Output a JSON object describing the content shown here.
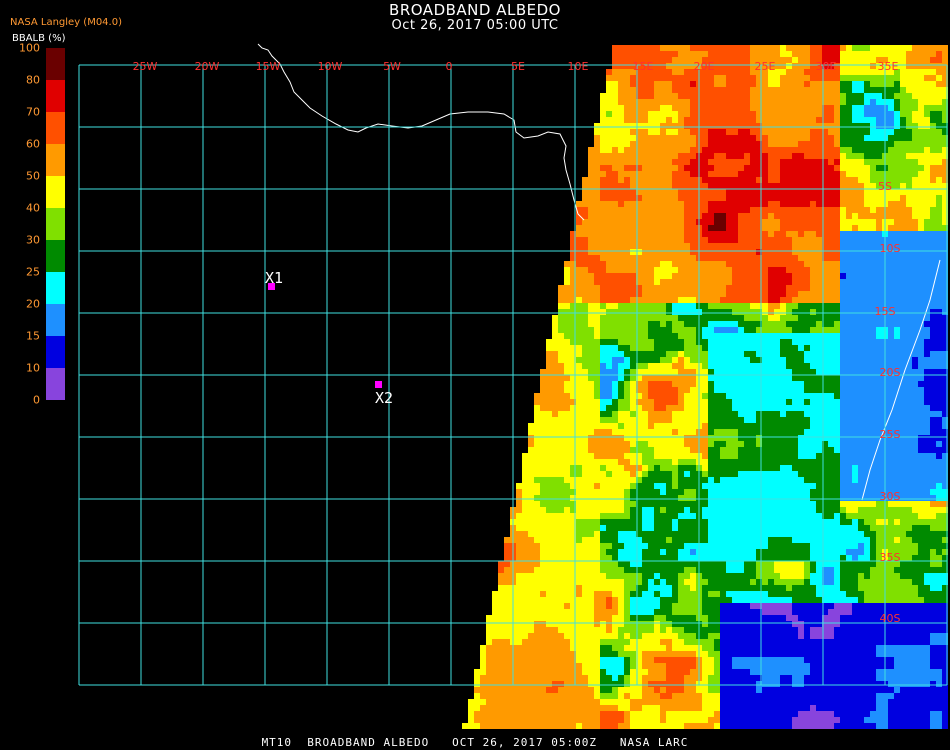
{
  "header": {
    "title": "BROADBAND ALBEDO",
    "subtitle": "Oct 26, 2017 05:00 UTC",
    "source": "NASA Langley (M04.0)"
  },
  "legend": {
    "unit_label": "BBALB (%)",
    "ticks": [
      "100",
      "80",
      "70",
      "60",
      "50",
      "40",
      "30",
      "25",
      "20",
      "15",
      "10",
      "0"
    ],
    "bands": [
      {
        "color": "#6a0000"
      },
      {
        "color": "#e00000"
      },
      {
        "color": "#ff5000"
      },
      {
        "color": "#ff9a00"
      },
      {
        "color": "#ffff00"
      },
      {
        "color": "#80e000"
      },
      {
        "color": "#008a00"
      },
      {
        "color": "#00ffff"
      },
      {
        "color": "#1e90ff"
      },
      {
        "color": "#0000e0"
      },
      {
        "color": "#8844dd"
      }
    ]
  },
  "map": {
    "longitude_labels": [
      "25W",
      "20W",
      "15W",
      "10W",
      "5W",
      "0",
      "5E",
      "10E",
      "15E",
      "20E",
      "25E",
      "30E",
      "35E"
    ],
    "latitude_labels": [
      "5S",
      "10S",
      "15S",
      "20S",
      "25S",
      "30S",
      "35S",
      "40S"
    ],
    "grid_color": "#40e0e0",
    "coast_color": "#ffffff",
    "markers": [
      {
        "label": "X1",
        "color": "#ff00ff"
      },
      {
        "label": "X2",
        "color": "#ff00ff"
      }
    ]
  },
  "footer": "MT10  BROADBAND ALBEDO   OCT 26, 2017 05:00Z   NASA LARC"
}
